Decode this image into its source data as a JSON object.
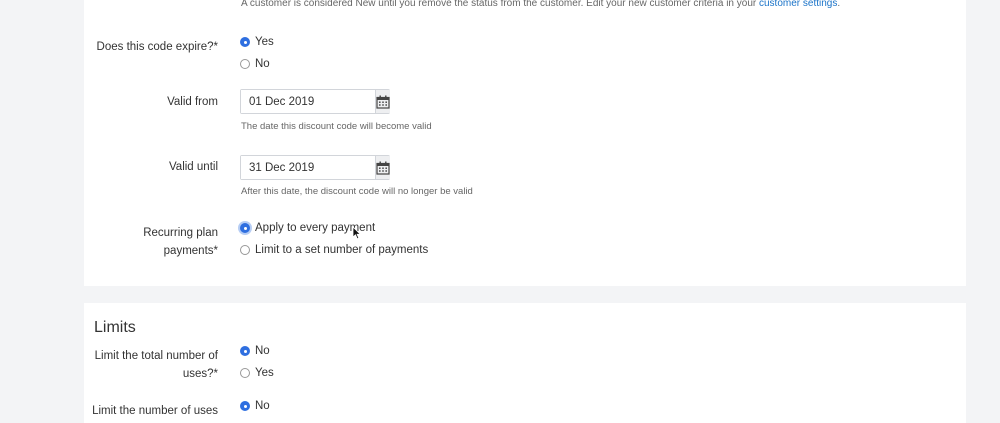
{
  "top_note": {
    "text": "A customer is considered New until you remove the status from the customer. Edit your new customer criteria in your",
    "link": "customer settings",
    "end": "."
  },
  "expire": {
    "label": "Does this code expire?*",
    "options": [
      "Yes",
      "No"
    ],
    "selected": "Yes"
  },
  "valid_from": {
    "label": "Valid from",
    "value": "01 Dec 2019",
    "help": "The date this discount code will become valid"
  },
  "valid_until": {
    "label": "Valid until",
    "value": "31 Dec 2019",
    "help": "After this date, the discount code will no longer be valid"
  },
  "recurring": {
    "label_line1": "Recurring plan",
    "label_line2": "payments*",
    "options": [
      "Apply to every payment",
      "Limit to a set number of payments"
    ],
    "selected": "Apply to every payment"
  },
  "limits": {
    "title": "Limits",
    "total_uses": {
      "label_line1": "Limit the total number of",
      "label_line2": "uses?*",
      "options": [
        "No",
        "Yes"
      ],
      "selected": "No"
    },
    "number_uses": {
      "label": "Limit the number of uses",
      "options": [
        "No"
      ],
      "selected": "No"
    }
  },
  "icons": {
    "calendar": "calendar-icon",
    "cursor": "mouse-pointer-icon"
  },
  "colors": {
    "accent": "#2f6fe0",
    "link": "#1a73c8",
    "page_bg": "#f3f4f6",
    "card_bg": "#ffffff"
  }
}
